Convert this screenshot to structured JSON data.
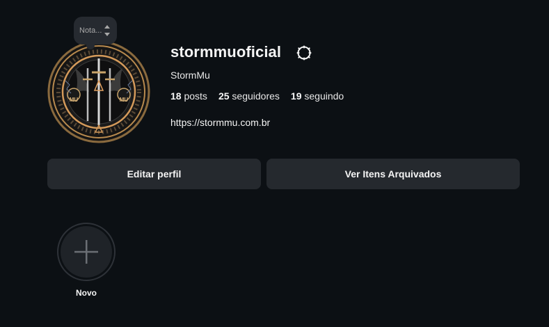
{
  "note": {
    "placeholder": "Nota..."
  },
  "profile": {
    "username": "stormmuoficial",
    "display_name": "StormMu",
    "website": "https://stormmu.com.br",
    "avatar_text_left": "MU",
    "avatar_text_right": "MU"
  },
  "stats": {
    "posts_count": "18",
    "posts_label": "posts",
    "followers_count": "25",
    "followers_label": "seguidores",
    "following_count": "19",
    "following_label": "seguindo"
  },
  "actions": {
    "edit_profile": "Editar perfil",
    "archived_items": "Ver Itens Arquivados"
  },
  "highlights": {
    "new_label": "Novo"
  },
  "colors": {
    "background": "#0c1014",
    "button_bg": "#25292e",
    "text_primary": "#f5f5f5",
    "avatar_gold": "#c9a46a"
  },
  "icons": {
    "options": "gear-icon",
    "add": "plus-icon",
    "note_stepper": "stepper-arrows-icon"
  }
}
